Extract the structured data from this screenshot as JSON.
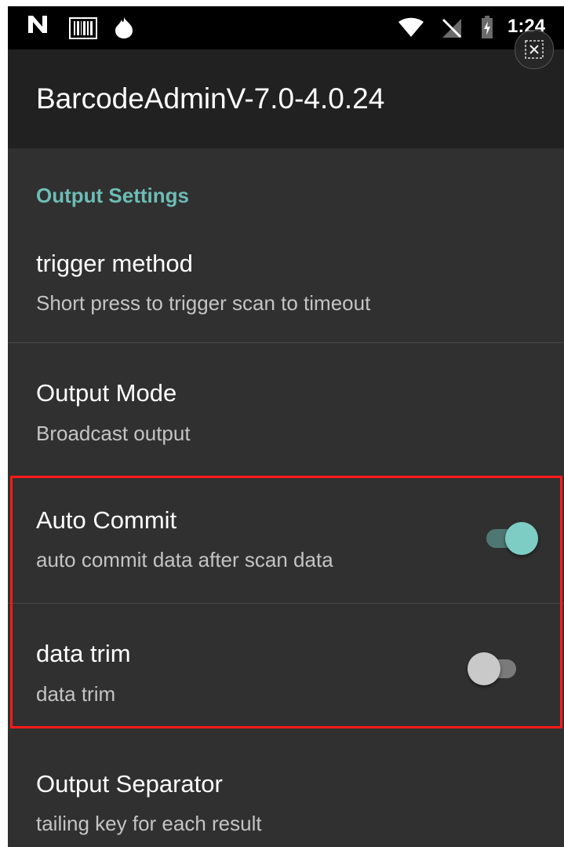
{
  "status_bar": {
    "time": "1:24",
    "icons": [
      "n-notification-icon",
      "barcode-icon",
      "flame-icon",
      "wifi-icon",
      "no-sim-icon",
      "battery-charging-icon"
    ]
  },
  "app_bar": {
    "title": "BarcodeAdminV-7.0-4.0.24"
  },
  "section": {
    "header": "Output Settings"
  },
  "preferences": [
    {
      "title": "trigger method",
      "summary": "Short press to trigger scan to timeout"
    },
    {
      "title": "Output Mode",
      "summary": "Broadcast output"
    },
    {
      "title": "Auto Commit",
      "summary": "auto commit data after scan data",
      "switch_on": true
    },
    {
      "title": "data trim",
      "summary": "data trim",
      "switch_on": false
    },
    {
      "title": "Output Separator",
      "summary": "tailing key for each result"
    }
  ],
  "colors": {
    "accent": "#6dbdb5",
    "switch_on_thumb": "#7ecdc4",
    "highlight_border": "#ff1a1a",
    "background": "#303030",
    "app_bar": "#212121"
  }
}
